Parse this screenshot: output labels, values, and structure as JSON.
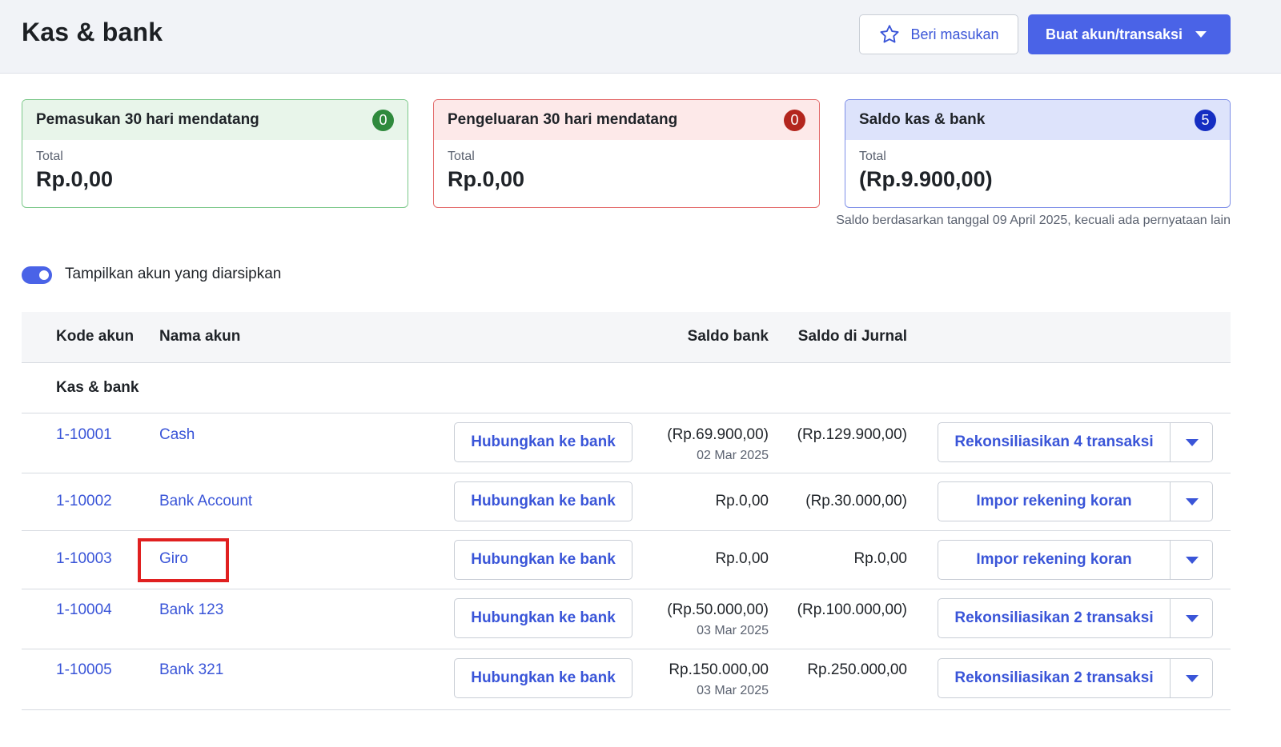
{
  "header": {
    "title": "Kas & bank",
    "feedback_label": "Beri masukan",
    "create_label": "Buat akun/transaksi"
  },
  "cards": {
    "income": {
      "title": "Pemasukan 30 hari mendatang",
      "count": "0",
      "sub": "Total",
      "value": "Rp.0,00"
    },
    "expense": {
      "title": "Pengeluaran 30 hari mendatang",
      "count": "0",
      "sub": "Total",
      "value": "Rp.0,00"
    },
    "balance": {
      "title": "Saldo kas & bank",
      "count": "5",
      "sub": "Total",
      "value": "(Rp.9.900,00)"
    }
  },
  "balance_note": "Saldo berdasarkan tanggal 09 April 2025, kecuali ada pernyataan lain",
  "toggle": {
    "label": "Tampilkan akun yang diarsipkan",
    "on": true
  },
  "table": {
    "headers": {
      "code": "Kode akun",
      "name": "Nama akun",
      "bank_balance": "Saldo bank",
      "journal_balance": "Saldo di Jurnal"
    },
    "group_label": "Kas & bank",
    "connect_label": "Hubungkan ke bank",
    "rows": [
      {
        "code": "1-10001",
        "name": "Cash",
        "bank_balance": "(Rp.69.900,00)",
        "bank_date": "02 Mar 2025",
        "journal_balance": "(Rp.129.900,00)",
        "action": "Rekonsiliasikan 4 transaksi"
      },
      {
        "code": "1-10002",
        "name": "Bank Account",
        "bank_balance": "Rp.0,00",
        "bank_date": "",
        "journal_balance": "(Rp.30.000,00)",
        "action": "Impor rekening koran"
      },
      {
        "code": "1-10003",
        "name": "Giro",
        "bank_balance": "Rp.0,00",
        "bank_date": "",
        "journal_balance": "Rp.0,00",
        "action": "Impor rekening koran"
      },
      {
        "code": "1-10004",
        "name": "Bank 123",
        "bank_balance": "(Rp.50.000,00)",
        "bank_date": "03 Mar 2025",
        "journal_balance": "(Rp.100.000,00)",
        "action": "Rekonsiliasikan 2 transaksi"
      },
      {
        "code": "1-10005",
        "name": "Bank 321",
        "bank_balance": "Rp.150.000,00",
        "bank_date": "03 Mar 2025",
        "journal_balance": "Rp.250.000,00",
        "action": "Rekonsiliasikan 2 transaksi"
      }
    ]
  },
  "colors": {
    "accent": "#4a63e7",
    "link": "#3a55d8",
    "highlight": "#e02020"
  },
  "icons": {
    "feedback": "star-icon",
    "create": "caret-down-icon",
    "row_action": "caret-down-icon"
  }
}
